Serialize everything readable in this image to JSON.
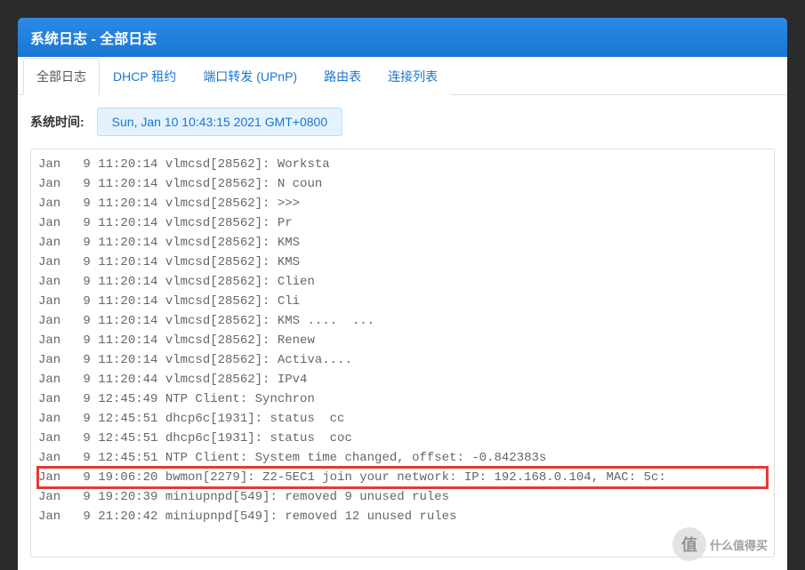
{
  "header": {
    "title": "系统日志 - 全部日志"
  },
  "tabs": [
    {
      "label": "全部日志",
      "active": true
    },
    {
      "label": "DHCP 租约",
      "active": false
    },
    {
      "label": "端口转发 (UPnP)",
      "active": false
    },
    {
      "label": "路由表",
      "active": false
    },
    {
      "label": "连接列表",
      "active": false
    }
  ],
  "system_time": {
    "label": "系统时间:",
    "value": "Sun, Jan 10 10:43:15 2021 GMT+0800"
  },
  "log_lines": [
    {
      "text": "Jan   9 11:20:14 vlmcsd[28562]: Worksta",
      "highlighted": false
    },
    {
      "text": "Jan   9 11:20:14 vlmcsd[28562]: N coun",
      "highlighted": false
    },
    {
      "text": "Jan   9 11:20:14 vlmcsd[28562]: >>>",
      "highlighted": false
    },
    {
      "text": "Jan   9 11:20:14 vlmcsd[28562]: Pr",
      "highlighted": false
    },
    {
      "text": "Jan   9 11:20:14 vlmcsd[28562]: KMS",
      "highlighted": false
    },
    {
      "text": "Jan   9 11:20:14 vlmcsd[28562]: KMS",
      "highlighted": false
    },
    {
      "text": "Jan   9 11:20:14 vlmcsd[28562]: Clien",
      "highlighted": false
    },
    {
      "text": "Jan   9 11:20:14 vlmcsd[28562]: Cli",
      "highlighted": false
    },
    {
      "text": "Jan   9 11:20:14 vlmcsd[28562]: KMS ....  ...",
      "highlighted": false
    },
    {
      "text": "Jan   9 11:20:14 vlmcsd[28562]: Renew",
      "highlighted": false
    },
    {
      "text": "Jan   9 11:20:14 vlmcsd[28562]: Activa....",
      "highlighted": false
    },
    {
      "text": "Jan   9 11:20:44 vlmcsd[28562]: IPv4",
      "highlighted": false
    },
    {
      "text": "Jan   9 12:45:49 NTP Client: Synchron",
      "highlighted": false
    },
    {
      "text": "Jan   9 12:45:51 dhcp6c[1931]: status  cc",
      "highlighted": false
    },
    {
      "text": "Jan   9 12:45:51 dhcp6c[1931]: status  coc",
      "highlighted": false
    },
    {
      "text": "Jan   9 12:45:51 NTP Client: System time changed, offset: -0.842383s",
      "highlighted": false
    },
    {
      "text": "Jan   9 19:06:20 bwmon[2279]: Z2-5EC1 join your network: IP: 192.168.0.104, MAC: 5c:",
      "highlighted": true
    },
    {
      "text": "Jan   9 19:20:39 miniupnpd[549]: removed 9 unused rules",
      "highlighted": false
    },
    {
      "text": "Jan   9 21:20:42 miniupnpd[549]: removed 12 unused rules",
      "highlighted": false
    }
  ],
  "watermark": {
    "symbol": "值",
    "text": "什么值得买"
  }
}
